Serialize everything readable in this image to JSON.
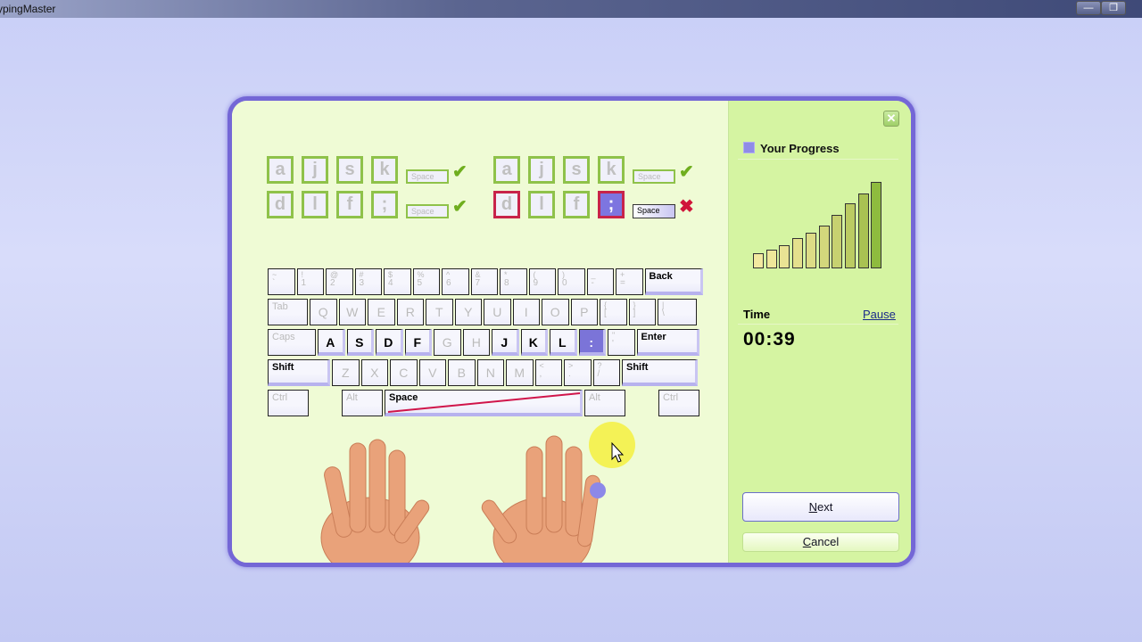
{
  "window": {
    "title": "TypingMaster",
    "title_visible": "ypingMaster",
    "minimize": "—",
    "restore": "❐"
  },
  "drill": {
    "left": {
      "row1": [
        "a",
        "j",
        "s",
        "k"
      ],
      "row2": [
        "d",
        "l",
        "f",
        ";"
      ],
      "space": "Space",
      "row1_result": "correct",
      "row2_result": "correct"
    },
    "right": {
      "row1": [
        "a",
        "j",
        "s",
        "k"
      ],
      "row2": [
        "d",
        "l",
        "f",
        ";"
      ],
      "space": "Space",
      "row1_result": "correct",
      "row2_result": "incorrect",
      "error_key": "d",
      "highlight_key": ";"
    }
  },
  "marks": {
    "correct": "✔",
    "incorrect": "✖"
  },
  "keyboard": {
    "rows": [
      [
        {
          "s": "~",
          "l": "`"
        },
        {
          "s": "!",
          "l": "1"
        },
        {
          "s": "@",
          "l": "2"
        },
        {
          "s": "#",
          "l": "3"
        },
        {
          "s": "$",
          "l": "4"
        },
        {
          "s": "%",
          "l": "5"
        },
        {
          "s": "^",
          "l": "6"
        },
        {
          "s": "&",
          "l": "7"
        },
        {
          "s": "*",
          "l": "8"
        },
        {
          "s": "(",
          "l": "9"
        },
        {
          "s": ")",
          "l": "0"
        },
        {
          "s": "_",
          "l": "-"
        },
        {
          "s": "+",
          "l": "="
        },
        {
          "t": "Back",
          "w": 65,
          "big": true
        }
      ],
      [
        {
          "t": "Tab",
          "w": 45
        },
        {
          "t": "Q",
          "L": 1
        },
        {
          "t": "W",
          "L": 1
        },
        {
          "t": "E",
          "L": 1
        },
        {
          "t": "R",
          "L": 1
        },
        {
          "t": "T",
          "L": 1
        },
        {
          "t": "Y",
          "L": 1
        },
        {
          "t": "U",
          "L": 1
        },
        {
          "t": "I",
          "L": 1
        },
        {
          "t": "O",
          "L": 1
        },
        {
          "t": "P",
          "L": 1
        },
        {
          "s": "{",
          "l": "["
        },
        {
          "s": "}",
          "l": "]"
        },
        {
          "s": "|",
          "l": "\\",
          "w": 44
        }
      ],
      [
        {
          "t": "Caps",
          "w": 54
        },
        {
          "t": "A",
          "on": 1
        },
        {
          "t": "S",
          "on": 1
        },
        {
          "t": "D",
          "on": 1
        },
        {
          "t": "F",
          "on": 1
        },
        {
          "t": "G",
          "L": 1
        },
        {
          "t": "H",
          "L": 1
        },
        {
          "t": "J",
          "on": 1
        },
        {
          "t": "K",
          "on": 1
        },
        {
          "t": "L",
          "on": 1
        },
        {
          "t": ":",
          "on": 1,
          "hl": 1
        },
        {
          "s": "\"",
          "l": "'"
        },
        {
          "t": "Enter",
          "w": 70,
          "big": true
        }
      ],
      [
        {
          "t": "Shift",
          "w": 70,
          "big": true
        },
        {
          "t": "Z",
          "L": 1
        },
        {
          "t": "X",
          "L": 1
        },
        {
          "t": "C",
          "L": 1
        },
        {
          "t": "V",
          "L": 1
        },
        {
          "t": "B",
          "L": 1
        },
        {
          "t": "N",
          "L": 1
        },
        {
          "t": "M",
          "L": 1
        },
        {
          "s": "<",
          "l": ","
        },
        {
          "s": ">",
          "l": "."
        },
        {
          "s": "?",
          "l": "/"
        },
        {
          "t": "Shift",
          "w": 85,
          "big": true
        }
      ],
      [
        {
          "t": "Ctrl",
          "w": 46
        },
        {
          "gap": 34
        },
        {
          "t": "Alt",
          "w": 46
        },
        {
          "t": "Space",
          "w": 222,
          "big": true,
          "space": 1
        },
        {
          "t": "Alt",
          "w": 46
        },
        {
          "gap": 34
        },
        {
          "t": "Ctrl",
          "w": 46
        }
      ]
    ]
  },
  "progress": {
    "title": "Your Progress",
    "bars": [
      51,
      62,
      77,
      101,
      119,
      145,
      180,
      219,
      254,
      292
    ],
    "bar_colors": [
      "#f3e9a0",
      "#efe79a",
      "#e9e394",
      "#e4e08d",
      "#dddc86",
      "#d3d77c",
      "#c7d170",
      "#bbcb62",
      "#a9c252",
      "#8ebb3e"
    ]
  },
  "timer": {
    "label": "Time",
    "pause": "Pause",
    "value": "00:39"
  },
  "buttons": {
    "next_pre": "",
    "next_u": "N",
    "next_rest": "ext",
    "cancel_u": "C",
    "cancel_rest": "ancel",
    "close": "✕"
  }
}
